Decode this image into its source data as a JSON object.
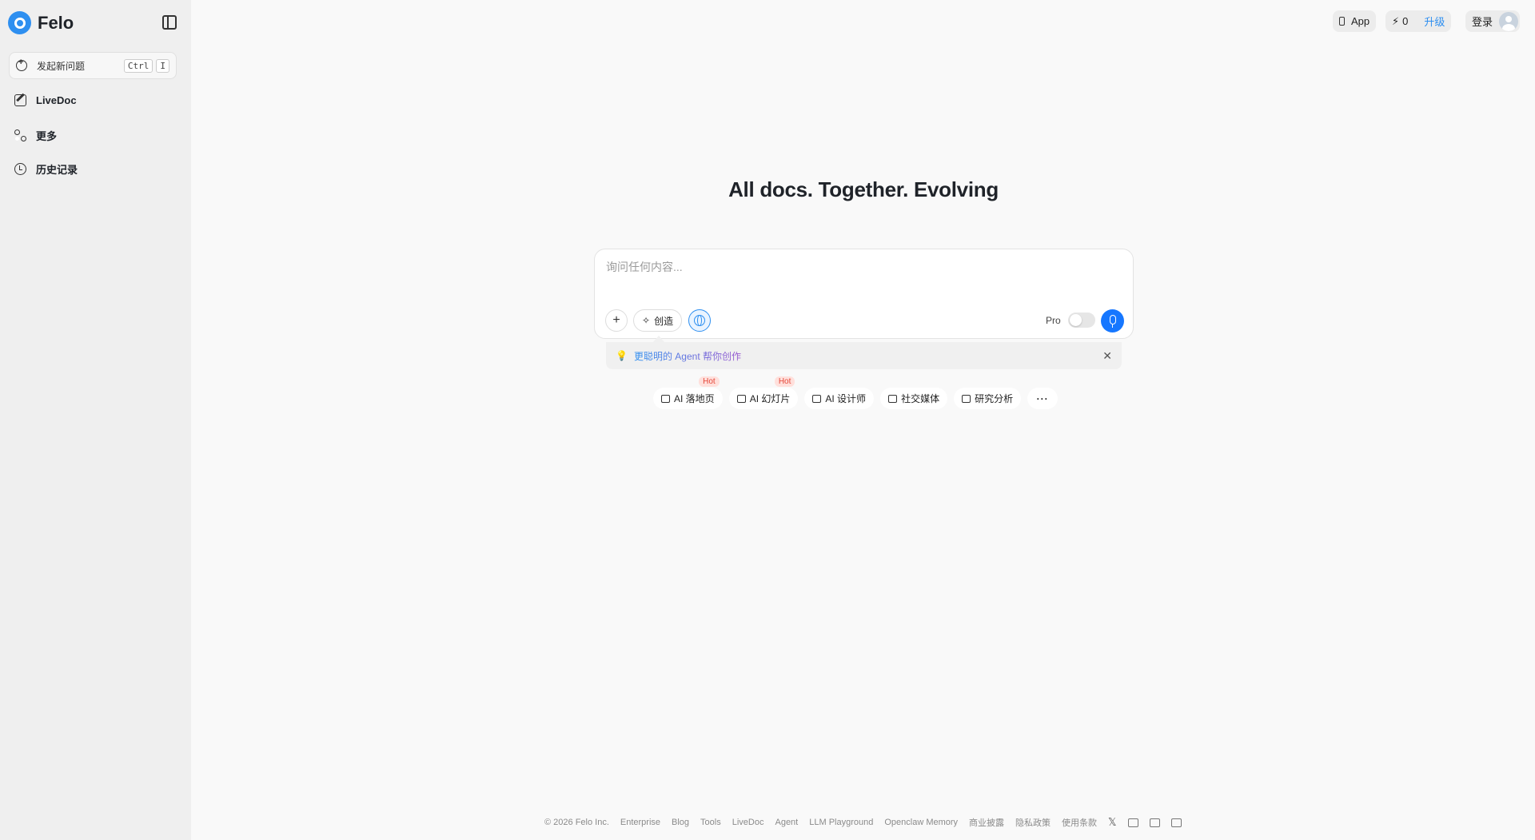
{
  "brand": {
    "name": "Felo"
  },
  "sidebar": {
    "new_question": {
      "label": "发起新问题",
      "key1": "Ctrl",
      "key2": "I"
    },
    "items": [
      {
        "label": "LiveDoc"
      },
      {
        "label": "更多"
      },
      {
        "label": "历史记录"
      }
    ]
  },
  "topbar": {
    "app_label": "App",
    "credits": "0",
    "upgrade_label": "升级",
    "login_label": "登录"
  },
  "main": {
    "headline": "All docs. Together. Evolving",
    "search": {
      "placeholder": "询问任何内容..."
    },
    "create_label": "创造",
    "pro_label": "Pro",
    "hint_text": "更聪明的 Agent 帮你创作",
    "chips": [
      {
        "label": "AI 落地页",
        "badge": "Hot"
      },
      {
        "label": "AI 幻灯片",
        "badge": "Hot"
      },
      {
        "label": "AI 设计师",
        "badge": ""
      },
      {
        "label": "社交媒体",
        "badge": ""
      },
      {
        "label": "研究分析",
        "badge": ""
      }
    ]
  },
  "footer": {
    "copyright": "© 2026  Felo Inc.",
    "links": [
      "Enterprise",
      "Blog",
      "Tools",
      "LiveDoc",
      "Agent",
      "LLM Playground",
      "Openclaw Memory",
      "商业披露",
      "隐私政策",
      "使用条款"
    ]
  },
  "colors": {
    "accent": "#1677ff",
    "hot_text": "#e5483a",
    "sidebar_bg": "#efefef"
  },
  "icons": [
    "felo-logo-icon",
    "sidebar-toggle-icon",
    "new-chat-icon",
    "edit-icon",
    "grid-icon",
    "history-icon",
    "phone-icon",
    "bolt-icon",
    "plus-icon",
    "sparkle-icon",
    "globe-icon",
    "mic-icon",
    "bulb-icon",
    "close-icon",
    "more-icon",
    "x-icon",
    "discord-icon",
    "youtube-icon",
    "mail-icon"
  ]
}
